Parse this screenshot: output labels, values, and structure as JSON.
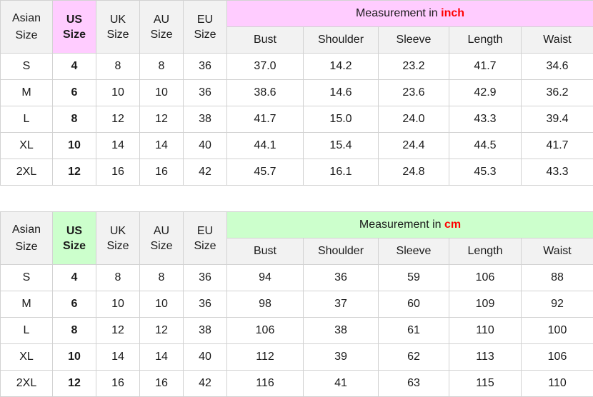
{
  "colors": {
    "header_bg": "#f2f2f2",
    "inch_highlight": "#ffccff",
    "cm_highlight": "#ccffcc",
    "unit_text": "#ff0000",
    "border": "#d2d2d2"
  },
  "headers": {
    "asian": [
      "Asian",
      "Size"
    ],
    "us": [
      "US",
      "Size"
    ],
    "uk": [
      "UK",
      "Size"
    ],
    "au": [
      "AU",
      "Size"
    ],
    "eu": [
      "EU",
      "Size"
    ],
    "measure_cols": [
      "Bust",
      "Shoulder",
      "Sleeve",
      "Length",
      "Waist"
    ]
  },
  "tables": [
    {
      "id": "inch",
      "title_prefix": "Measurement in ",
      "unit": "inch",
      "highlight": "#ffccff",
      "rows": [
        {
          "asian": "S",
          "us": "4",
          "uk": "8",
          "au": "8",
          "eu": "36",
          "values": [
            "37.0",
            "14.2",
            "23.2",
            "41.7",
            "34.6"
          ]
        },
        {
          "asian": "M",
          "us": "6",
          "uk": "10",
          "au": "10",
          "eu": "36",
          "values": [
            "38.6",
            "14.6",
            "23.6",
            "42.9",
            "36.2"
          ]
        },
        {
          "asian": "L",
          "us": "8",
          "uk": "12",
          "au": "12",
          "eu": "38",
          "values": [
            "41.7",
            "15.0",
            "24.0",
            "43.3",
            "39.4"
          ]
        },
        {
          "asian": "XL",
          "us": "10",
          "uk": "14",
          "au": "14",
          "eu": "40",
          "values": [
            "44.1",
            "15.4",
            "24.4",
            "44.5",
            "41.7"
          ]
        },
        {
          "asian": "2XL",
          "us": "12",
          "uk": "16",
          "au": "16",
          "eu": "42",
          "values": [
            "45.7",
            "16.1",
            "24.8",
            "45.3",
            "43.3"
          ]
        }
      ]
    },
    {
      "id": "cm",
      "title_prefix": "Measurement in ",
      "unit": "cm",
      "highlight": "#ccffcc",
      "rows": [
        {
          "asian": "S",
          "us": "4",
          "uk": "8",
          "au": "8",
          "eu": "36",
          "values": [
            "94",
            "36",
            "59",
            "106",
            "88"
          ]
        },
        {
          "asian": "M",
          "us": "6",
          "uk": "10",
          "au": "10",
          "eu": "36",
          "values": [
            "98",
            "37",
            "60",
            "109",
            "92"
          ]
        },
        {
          "asian": "L",
          "us": "8",
          "uk": "12",
          "au": "12",
          "eu": "38",
          "values": [
            "106",
            "38",
            "61",
            "110",
            "100"
          ]
        },
        {
          "asian": "XL",
          "us": "10",
          "uk": "14",
          "au": "14",
          "eu": "40",
          "values": [
            "112",
            "39",
            "62",
            "113",
            "106"
          ]
        },
        {
          "asian": "2XL",
          "us": "12",
          "uk": "16",
          "au": "16",
          "eu": "42",
          "values": [
            "116",
            "41",
            "63",
            "115",
            "110"
          ]
        }
      ]
    }
  ]
}
